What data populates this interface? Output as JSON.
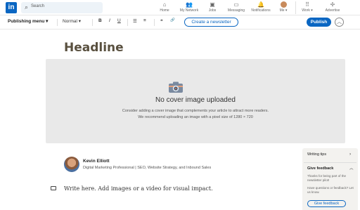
{
  "nav": {
    "logo": "in",
    "search_placeholder": "Search",
    "items": [
      {
        "label": "Home",
        "icon": "home-icon"
      },
      {
        "label": "My Network",
        "icon": "network-icon"
      },
      {
        "label": "Jobs",
        "icon": "briefcase-icon"
      },
      {
        "label": "Messaging",
        "icon": "chat-icon"
      },
      {
        "label": "Notifications",
        "icon": "bell-icon"
      },
      {
        "label": "Me ▾",
        "icon": "avatar"
      },
      {
        "label": "Work ▾",
        "icon": "grid-icon"
      },
      {
        "label": "Advertise",
        "icon": "compass-icon"
      }
    ]
  },
  "toolbar": {
    "menu_label": "Publishing menu",
    "style_select": "Normal",
    "bold": "B",
    "italic": "I",
    "underline": "U",
    "bullet_list": "☰",
    "numbered_list": "≡",
    "quote": "❝",
    "link": "🔗",
    "newsletter_button": "Create a newsletter",
    "publish_button": "Publish",
    "collapse_icon": "︿"
  },
  "article": {
    "headline": "Headline",
    "cover_title": "No cover image uploaded",
    "cover_desc_1": "Consider adding a cover image that complements your article to attract more readers.",
    "cover_desc_2": "We recommend uploading an image with a pixel size of 1280 × 720",
    "author_name": "Kevin Elliott",
    "author_desc": "Digital Marketing Professional | SEO, Website Strategy, and Inbound Sales",
    "editor_placeholder": "Write here. Add images or a video for visual impact."
  },
  "side_panel": {
    "writing_tips": "Writing tips",
    "give_feedback": "Give feedback",
    "thanks_text": "Thanks for being part of the newsletter pilot!",
    "questions_text": "Have questions or feedback? Let us know.",
    "feedback_button": "Give feedback"
  },
  "colors": {
    "brand": "#0a66c2",
    "headline": "#59503f",
    "cover_bg": "#e9e9e9"
  }
}
